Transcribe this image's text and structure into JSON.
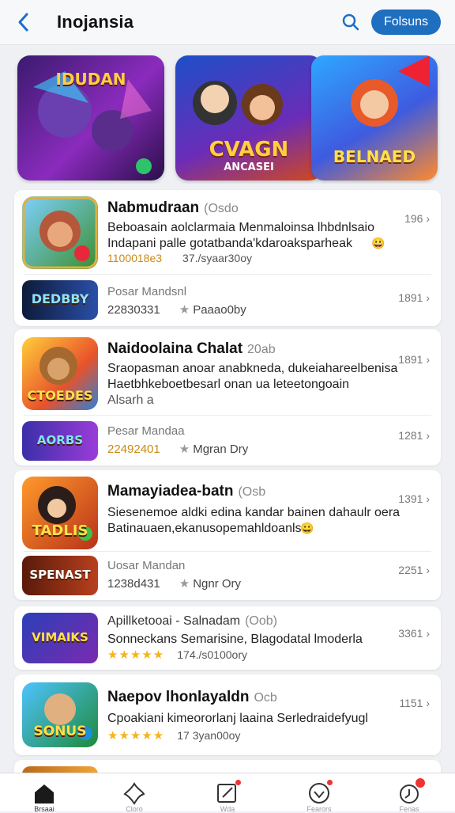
{
  "header": {
    "title": "Inojansia",
    "follow_label": "Folsuns"
  },
  "featured": [
    {
      "top_text": "IDUDAN",
      "bottom_text": ""
    },
    {
      "top_text": "CVAGN",
      "bottom_text": "ANCASEI"
    },
    {
      "top_text": "BELNAED",
      "bottom_text": ""
    }
  ],
  "apps": [
    {
      "name": "Nabmudraan",
      "tag": "(Osdo",
      "desc1": "Beboasain aolclarmaia Menmaloinsa lhbdnlsaio",
      "desc2": "Indapani palle gotatbanda'kdaroaksparheak",
      "meta_a": "1100018e3",
      "meta_b": "37./syaar30oy",
      "count": "196",
      "icon_label": "",
      "sub": {
        "name": "Posar Mandsnl",
        "meta_a": "22830331",
        "meta_b": "Paaao0by",
        "count": "1891",
        "icon_label": "DEDBBY"
      }
    },
    {
      "name": "Naidoolaina Chalat",
      "tag": "20ab",
      "desc1": "Sraopasman anoar anabkneda, dukeiahareelbenisa",
      "desc2": "Haetbhkeboetbesarl onan ua leteetongoain",
      "desc3": "Alsarh a",
      "count": "1891",
      "icon_label": "CTOEDES",
      "sub": {
        "name": "Pesar Mandaa",
        "meta_a": "22492401",
        "meta_b": "Mgran Dry",
        "count": "1281",
        "icon_label": "AORBS"
      }
    },
    {
      "name": "Mamayiadea-batn",
      "tag": "(Osb",
      "desc1": "Siesenemoe aldki edina kandar bainen dahaulr oera",
      "desc2": "Batinauaen,ekanusopemahldoanls",
      "count": "1391",
      "icon_label": "TADLIS",
      "sub": {
        "name": "Uosar Mandan",
        "meta_a": "1238d431",
        "meta_b": "Ngnr Ory",
        "count": "2251",
        "icon_label": "SPENAST"
      }
    },
    {
      "name": "Apillketooai - Salnadam",
      "tag": "(Oob)",
      "desc1": "Sonneckans Semarisine, Blagodatal lmoderla",
      "stars": "★★★★★",
      "meta_b": "174./s0100ory",
      "count": "3361",
      "icon_label": "VIMAIKS"
    },
    {
      "name": "Naepov lhonlayaldn",
      "tag": "Ocb",
      "desc1": "Cpoakiani kimeororlanj laaina Serledraidefyugl",
      "stars": "★★★★★",
      "meta_b": "17 3yan00oy",
      "count": "1151",
      "icon_label": "SONUS"
    }
  ],
  "tabs": [
    {
      "label": "Brsaai"
    },
    {
      "label": "Cloro"
    },
    {
      "label": "Wda"
    },
    {
      "label": "Fearors"
    },
    {
      "label": "Fenas"
    }
  ],
  "colors": {
    "accent": "#1f6fc1",
    "star": "#f3b51b",
    "badge": "#e33333"
  }
}
